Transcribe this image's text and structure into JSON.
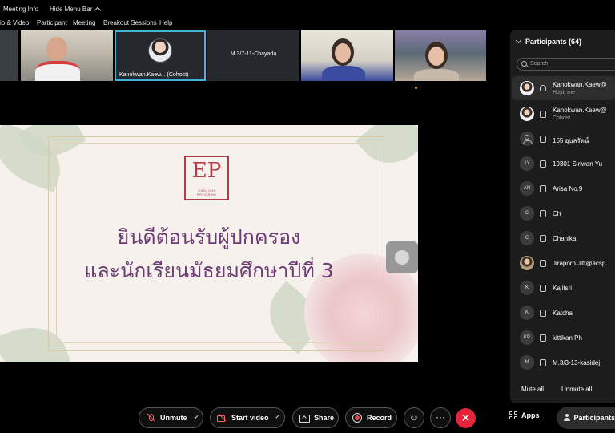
{
  "topbar": {
    "meeting_info": "Meeting Info",
    "hide_menu_bar": "Hide Menu Bar"
  },
  "menu": {
    "audio_video": "io & Video",
    "participant": "Participant",
    "meeting": "Meeting",
    "breakout": "Breakout Sessions",
    "help": "Help"
  },
  "video_tiles": [
    {
      "label": ""
    },
    {
      "label": ""
    },
    {
      "label": "Kanokwan.Kaew...  (Cohost)"
    },
    {
      "label": "M.3/7-11-Chayada"
    },
    {
      "label": ""
    },
    {
      "label": ""
    }
  ],
  "slide": {
    "logo_text": "EP",
    "logo_sub_1": "ENGLISH",
    "logo_sub_2": "PROGRAM",
    "line1": "ยินดีต้อนรับผู้ปกครอง",
    "line2": "และนักเรียนมัธยมศึกษาปีที่ 3"
  },
  "panel": {
    "title": "Participants (64)",
    "search_placeholder": "Search",
    "participants": [
      {
        "initials": "",
        "name": "Kanokwan.Kaew@",
        "role": "Host, me",
        "media": "headset"
      },
      {
        "initials": "",
        "name": "Kanokwan.Kaew@",
        "role": "Cohost",
        "media": "device"
      },
      {
        "initials": "",
        "name": "165 อุบลรัตน์",
        "role": "",
        "media": "device"
      },
      {
        "initials": "1Y",
        "name": "19301 Siriwan Yu",
        "role": "",
        "media": "device"
      },
      {
        "initials": "AN",
        "name": "Arisa No.9",
        "role": "",
        "media": "device"
      },
      {
        "initials": "C",
        "name": "Ch",
        "role": "",
        "media": "device"
      },
      {
        "initials": "C",
        "name": "Chanika",
        "role": "",
        "media": "device"
      },
      {
        "initials": "",
        "name": "Jiraporn.Jitt@acsp",
        "role": "",
        "media": "device"
      },
      {
        "initials": "K",
        "name": "Kajitsri",
        "role": "",
        "media": "device"
      },
      {
        "initials": "K",
        "name": "Katcha",
        "role": "",
        "media": "device"
      },
      {
        "initials": "KP",
        "name": "kittikan Ph",
        "role": "",
        "media": "device"
      },
      {
        "initials": "M",
        "name": "M.3/3-13-kasidej",
        "role": "",
        "media": "device"
      }
    ],
    "mute_all": "Mute all",
    "unmute_all": "Unmute all"
  },
  "controls": {
    "unmute": "Unmute",
    "start_video": "Start video",
    "share": "Share",
    "record": "Record",
    "more": "···",
    "end": "✕",
    "apps": "Apps",
    "participants": "Participants"
  },
  "colors": {
    "accent_border": "#45b3d6",
    "end_call": "#e5243b",
    "slide_text": "#6b3c73",
    "logo": "#b33c48"
  }
}
